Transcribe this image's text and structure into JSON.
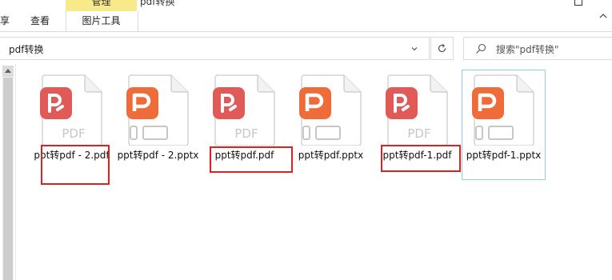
{
  "ribbon": {
    "context_group_label": "管理",
    "window_title": "pdf转换",
    "tabs": [
      {
        "label": "享"
      },
      {
        "label": "查看"
      },
      {
        "label": "图片工具"
      }
    ]
  },
  "address_bar": {
    "path": "pdf转换"
  },
  "search": {
    "placeholder": "搜索\"pdf转换\""
  },
  "colors": {
    "pdf_badge": "#e05a58",
    "pptx_badge": "#ef6b3a",
    "highlight_box": "#e02020",
    "selection_border": "#8fd0e6",
    "context_tab_band": "#f8e98b"
  },
  "files": [
    {
      "name": "ppt转pdf - 2.pdf",
      "type": "pdf",
      "icon": "wps-pdf-icon",
      "highlighted": true
    },
    {
      "name": "ppt转pdf - 2.pptx",
      "type": "pptx",
      "icon": "wps-presentation-icon",
      "highlighted": false
    },
    {
      "name": "ppt转pdf.pdf",
      "type": "pdf",
      "icon": "wps-pdf-icon",
      "highlighted": true
    },
    {
      "name": "ppt转pdf.pptx",
      "type": "pptx",
      "icon": "wps-presentation-icon",
      "highlighted": false
    },
    {
      "name": "ppt转pdf-1.pdf",
      "type": "pdf",
      "icon": "wps-pdf-icon",
      "highlighted": true
    },
    {
      "name": "ppt转pdf-1.pptx",
      "type": "pptx",
      "icon": "wps-presentation-icon",
      "highlighted": false,
      "selected": true
    }
  ],
  "icon_texts": {
    "pdf": "PDF"
  }
}
